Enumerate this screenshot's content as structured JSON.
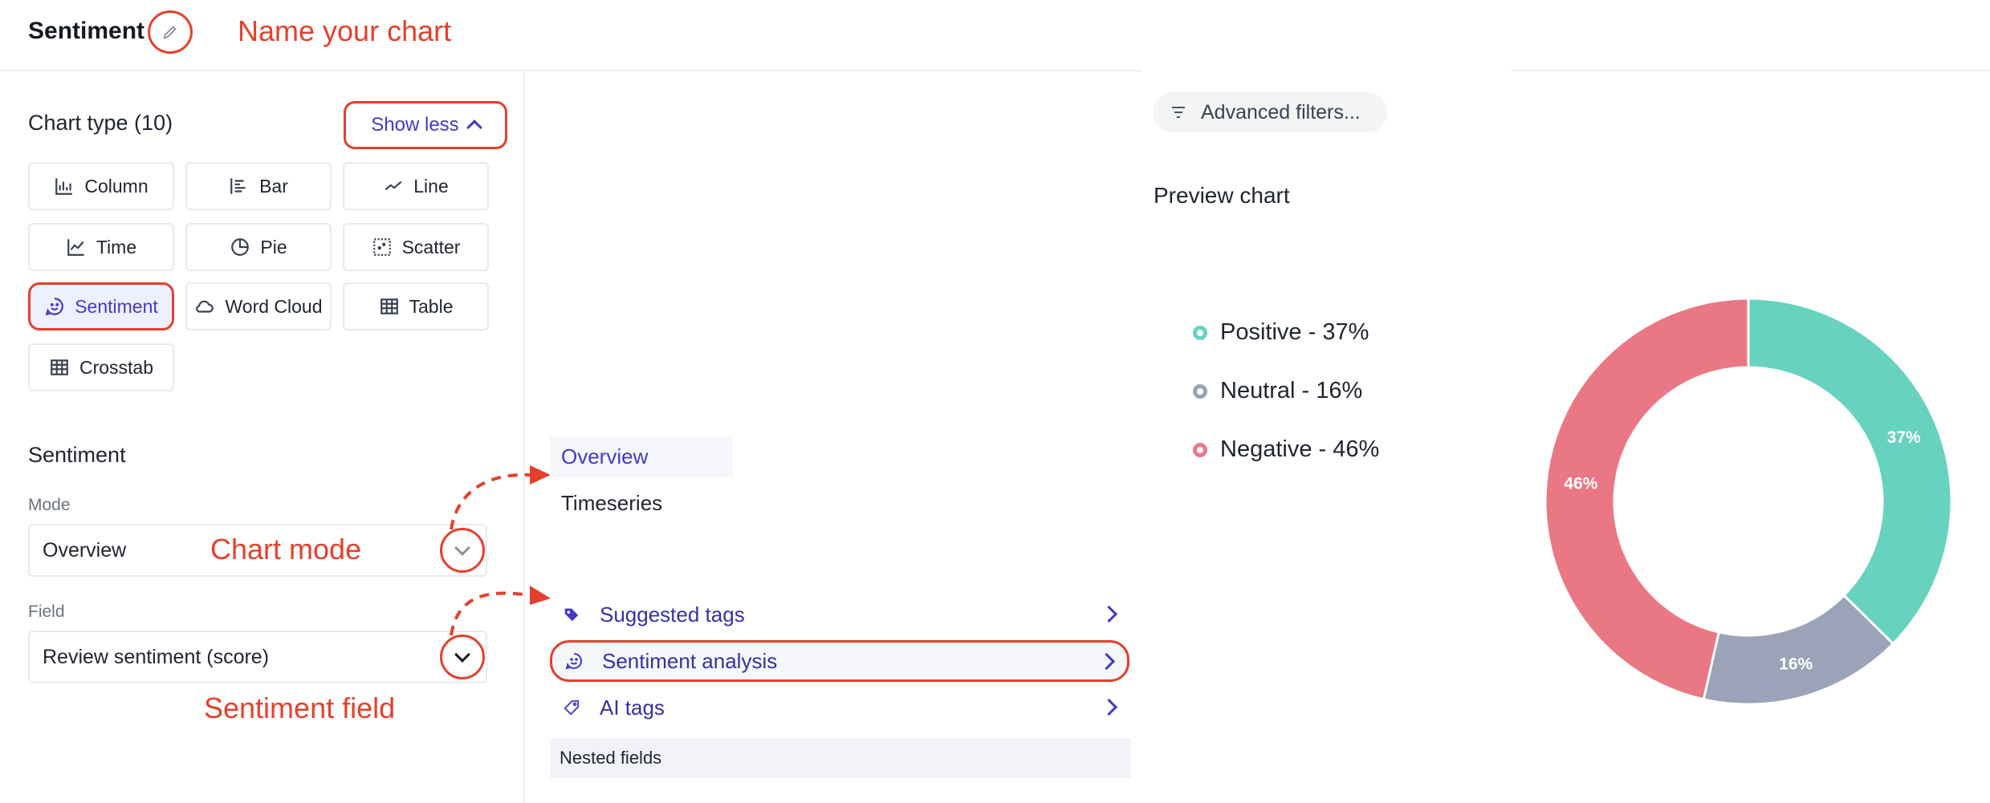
{
  "header": {
    "title": "Sentiment",
    "annotation": "Name your chart"
  },
  "chart_type": {
    "title": "Chart type (10)",
    "toggle_label": "Show less",
    "types": [
      {
        "label": "Column",
        "icon": "column-chart-icon"
      },
      {
        "label": "Bar",
        "icon": "bar-chart-icon"
      },
      {
        "label": "Line",
        "icon": "line-chart-icon"
      },
      {
        "label": "Time",
        "icon": "time-chart-icon"
      },
      {
        "label": "Pie",
        "icon": "pie-chart-icon"
      },
      {
        "label": "Scatter",
        "icon": "scatter-chart-icon"
      },
      {
        "label": "Sentiment",
        "icon": "sentiment-icon",
        "selected": true
      },
      {
        "label": "Word Cloud",
        "icon": "cloud-icon"
      },
      {
        "label": "Table",
        "icon": "table-icon"
      },
      {
        "label": "Crosstab",
        "icon": "crosstab-icon"
      }
    ]
  },
  "sentiment": {
    "title": "Sentiment",
    "mode_label": "Mode",
    "mode_value": "Overview",
    "mode_annotation": "Chart mode",
    "field_label": "Field",
    "field_value": "Review sentiment (score)",
    "field_annotation": "Sentiment field"
  },
  "mode_options": [
    "Overview",
    "Timeseries"
  ],
  "field_options": [
    "Suggested tags",
    "Sentiment analysis",
    "AI tags"
  ],
  "nested_label": "Nested fields",
  "filters": {
    "advanced_label": "Advanced filters..."
  },
  "preview": {
    "title": "Preview chart"
  },
  "colors": {
    "positive": "#67d2c0",
    "neutral": "#9aa3b7",
    "negative": "#e97884",
    "accent": "#4338ca",
    "annotation": "#e5402b"
  },
  "chart_data": {
    "type": "pie",
    "donut": true,
    "categories": [
      "Positive",
      "Neutral",
      "Negative"
    ],
    "values": [
      37,
      16,
      46
    ],
    "legend": [
      "Positive - 37%",
      "Neutral - 16%",
      "Negative - 46%"
    ],
    "data_labels": [
      "37%",
      "16%",
      "46%"
    ],
    "legend_position": "left"
  }
}
